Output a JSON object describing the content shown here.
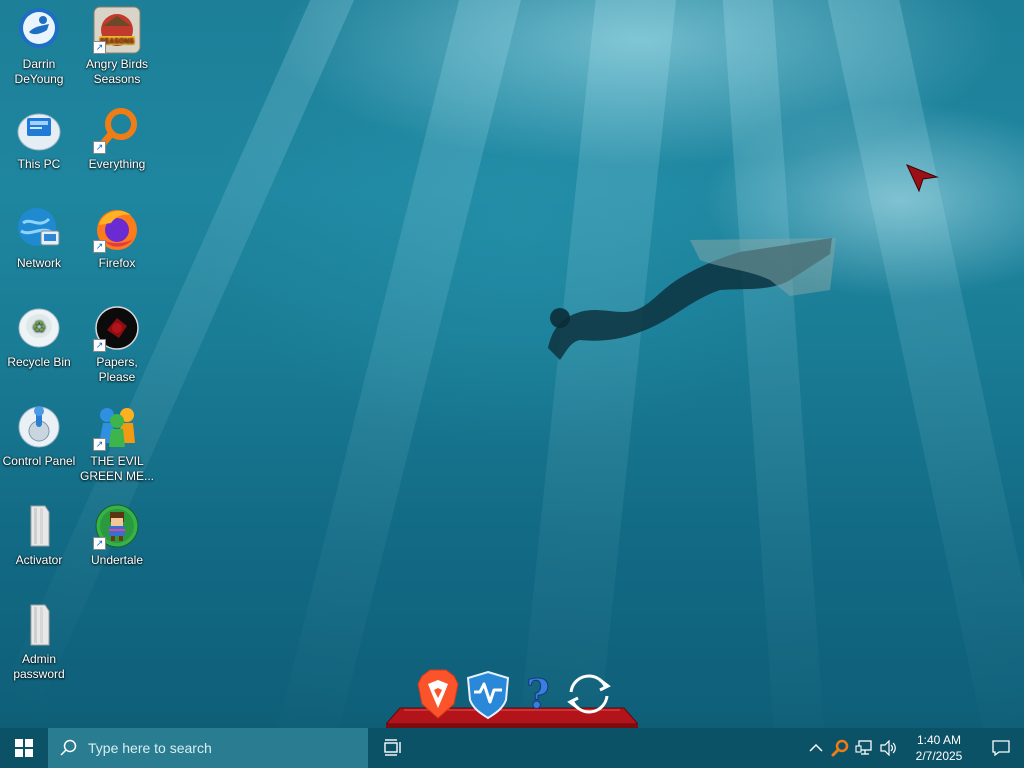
{
  "desktop_icons": [
    {
      "label": "Darrin DeYoung",
      "icon": "user-folder-icon",
      "shortcut": false
    },
    {
      "label": "Angry Birds Seasons",
      "icon": "angry-birds-icon",
      "shortcut": true,
      "badge": "SEASONS"
    },
    {
      "label": "This PC",
      "icon": "computer-icon",
      "shortcut": false
    },
    {
      "label": "Everything",
      "icon": "everything-search-icon",
      "shortcut": true
    },
    {
      "label": "Network",
      "icon": "network-icon",
      "shortcut": false
    },
    {
      "label": "Firefox",
      "icon": "firefox-icon",
      "shortcut": true
    },
    {
      "label": "Recycle Bin",
      "icon": "recycle-bin-icon",
      "shortcut": false
    },
    {
      "label": "Papers, Please",
      "icon": "papers-please-icon",
      "shortcut": true
    },
    {
      "label": "Control Panel",
      "icon": "control-panel-icon",
      "shortcut": false
    },
    {
      "label": "THE EVIL GREEN ME...",
      "icon": "messenger-people-icon",
      "shortcut": true
    },
    {
      "label": "Activator",
      "icon": "folder-icon",
      "shortcut": false
    },
    {
      "label": "Undertale",
      "icon": "undertale-icon",
      "shortcut": true
    },
    {
      "label": "Admin password",
      "icon": "folder-icon",
      "shortcut": false
    }
  ],
  "dock": {
    "items": [
      "brave-browser-icon",
      "wise-care-icon",
      "help-icon",
      "refresh-icon"
    ],
    "shelf_color": "#b3141a"
  },
  "taskbar": {
    "search_placeholder": "Type here to search",
    "time": "1:40 AM",
    "date": "2/7/2025",
    "bg_color": "#0c5266",
    "search_bg": "#2a7d91"
  },
  "colors": {
    "water_top": "#1d7f98",
    "water_bottom": "#0e5c76"
  }
}
